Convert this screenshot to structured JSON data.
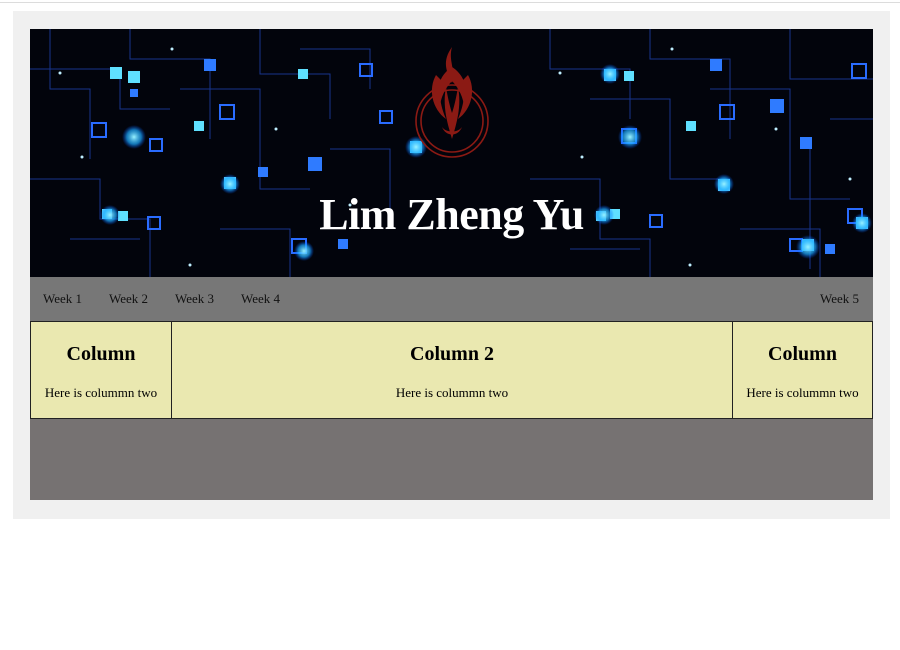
{
  "header": {
    "title": "Lim Zheng Yu",
    "logo": "phoenix-emblem",
    "background": "circuit-board-pattern"
  },
  "nav": {
    "items": [
      {
        "label": "Week 1"
      },
      {
        "label": "Week 2"
      },
      {
        "label": "Week 3"
      },
      {
        "label": "Week 4"
      },
      {
        "label": "Week 5"
      }
    ]
  },
  "columns": [
    {
      "heading": "Column",
      "text": "Here is colummn two"
    },
    {
      "heading": "Column 2",
      "text": "Here is colummn two"
    },
    {
      "heading": "Column",
      "text": "Here is colummn two"
    }
  ],
  "colors": {
    "nav_bg": "#777777",
    "column_bg": "#eae8b0",
    "footer_bg": "#767272",
    "emblem": "#8b1a14",
    "circuit_glow": "#3ad0ff"
  }
}
